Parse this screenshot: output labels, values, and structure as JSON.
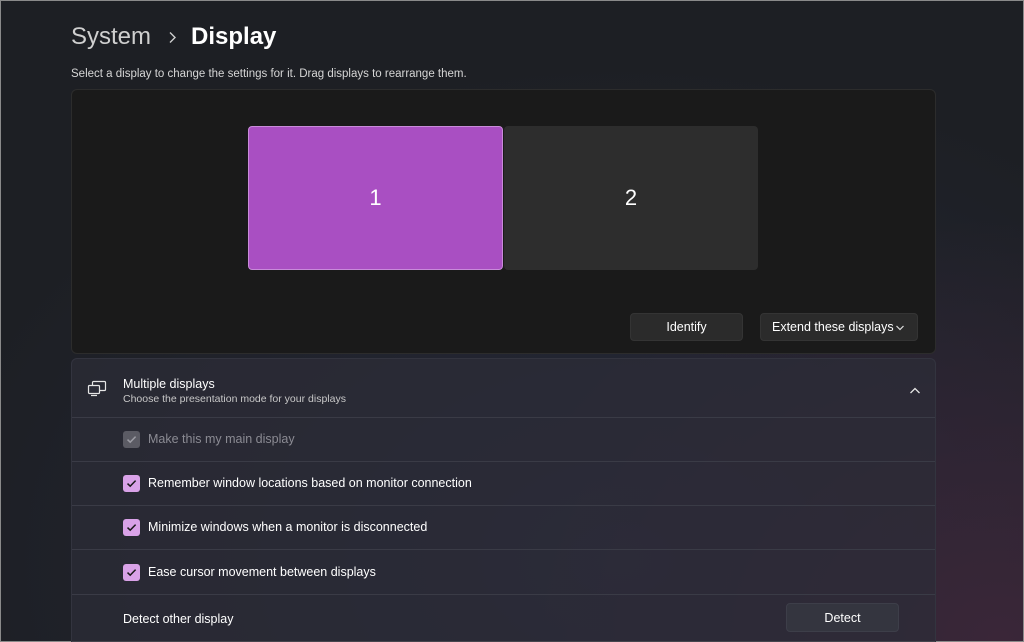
{
  "breadcrumb": {
    "parent": "System",
    "current": "Display"
  },
  "description": "Select a display to change the settings for it. Drag displays to rearrange them.",
  "arrangement": {
    "monitors": [
      {
        "label": "1",
        "selected": true
      },
      {
        "label": "2",
        "selected": false
      }
    ],
    "identify_label": "Identify",
    "mode_label": "Extend these displays"
  },
  "multiple_displays": {
    "title": "Multiple displays",
    "subtitle": "Choose the presentation mode for your displays",
    "expanded": true,
    "options": [
      {
        "label": "Make this my main display",
        "checked": true,
        "disabled": true
      },
      {
        "label": "Remember window locations based on monitor connection",
        "checked": true,
        "disabled": false
      },
      {
        "label": "Minimize windows when a monitor is disconnected",
        "checked": true,
        "disabled": false
      },
      {
        "label": "Ease cursor movement between displays",
        "checked": true,
        "disabled": false
      }
    ],
    "detect_row": {
      "label": "Detect other display",
      "button_label": "Detect"
    }
  },
  "colors": {
    "accent": "#a94fc2",
    "checkbox": "#d9a2e8"
  },
  "icons": [
    "chevron-right-icon",
    "chevron-down-icon",
    "chevron-up-icon",
    "multiple-displays-icon",
    "checkmark-icon"
  ]
}
